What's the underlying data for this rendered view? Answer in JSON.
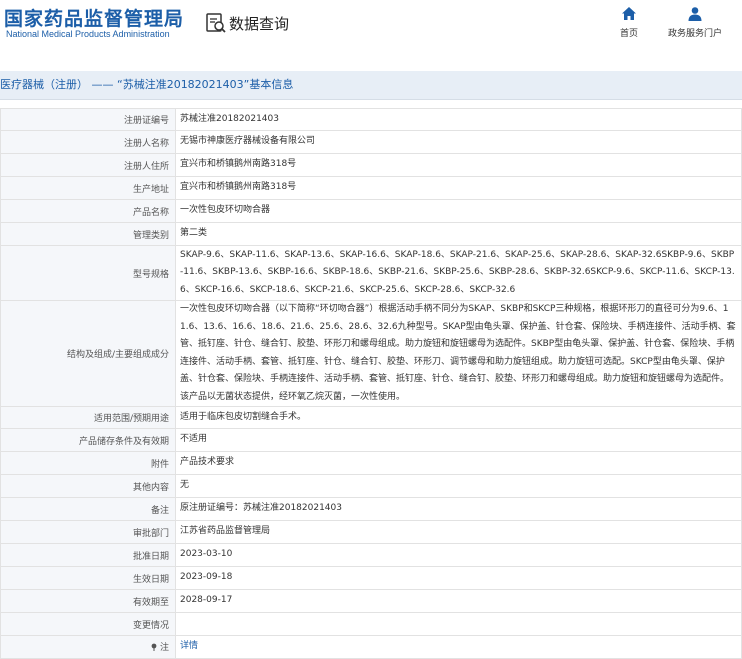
{
  "header": {
    "logo_cn": "国家药品监督管理局",
    "logo_en": "National Medical Products Administration",
    "query_label": "数据查询",
    "nav": {
      "home": "首页",
      "portal": "政务服务门户"
    }
  },
  "title": "医疗器械（注册） —— “苏械注准20182021403”基本信息",
  "rows": [
    {
      "k": "注册证编号",
      "v": "苏械注准20182021403"
    },
    {
      "k": "注册人名称",
      "v": "无锡市神康医疗器械设备有限公司"
    },
    {
      "k": "注册人住所",
      "v": "宜兴市和桥镇鹅州南路318号"
    },
    {
      "k": "生产地址",
      "v": "宜兴市和桥镇鹅州南路318号"
    },
    {
      "k": "产品名称",
      "v": "一次性包皮环切吻合器"
    },
    {
      "k": "管理类别",
      "v": "第二类"
    },
    {
      "k": "型号规格",
      "v": "SKAP-9.6、SKAP-11.6、SKAP-13.6、SKAP-16.6、SKAP-18.6、SKAP-21.6、SKAP-25.6、SKAP-28.6、SKAP-32.6SKBP-9.6、SKBP-11.6、SKBP-13.6、SKBP-16.6、SKBP-18.6、SKBP-21.6、SKBP-25.6、SKBP-28.6、SKBP-32.6SKCP-9.6、SKCP-11.6、SKCP-13.6、SKCP-16.6、SKCP-18.6、SKCP-21.6、SKCP-25.6、SKCP-28.6、SKCP-32.6"
    },
    {
      "k": "结构及组成/主要组成成分",
      "v": "一次性包皮环切吻合器（以下简称“环切吻合器”）根据活动手柄不同分为SKAP、SKBP和SKCP三种规格，根据环形刀的直径可分为9.6、11.6、13.6、16.6、18.6、21.6、25.6、28.6、32.6九种型号。SKAP型由龟头罩、保护盖、针仓套、保险块、手柄连接件、活动手柄、套管、抵钉座、针仓、缝合钉、胶垫、环形刀和螺母组成。助力旋钮和旋钮螺母为选配件。SKBP型由龟头罩、保护盖、针仓套、保险块、手柄连接件、活动手柄、套管、抵钉座、针仓、缝合钉、胶垫、环形刀、调节螺母和助力旋钮组成。助力旋钮可选配。SKCP型由龟头罩、保护盖、针仓套、保险块、手柄连接件、活动手柄、套管、抵钉座、针仓、缝合钉、胶垫、环形刀和螺母组成。助力旋钮和旋钮螺母为选配件。该产品以无菌状态提供，经环氧乙烷灭菌，一次性使用。"
    },
    {
      "k": "适用范围/预期用途",
      "v": "适用于临床包皮切割缝合手术。"
    },
    {
      "k": "产品储存条件及有效期",
      "v": "不适用"
    },
    {
      "k": "附件",
      "v": "产品技术要求"
    },
    {
      "k": "其他内容",
      "v": "无"
    },
    {
      "k": "备注",
      "v": "原注册证编号：苏械注准20182021403"
    },
    {
      "k": "审批部门",
      "v": "江苏省药品监督管理局"
    },
    {
      "k": "批准日期",
      "v": "2023-03-10"
    },
    {
      "k": "生效日期",
      "v": "2023-09-18"
    },
    {
      "k": "有效期至",
      "v": "2028-09-17"
    },
    {
      "k": "变更情况",
      "v": ""
    }
  ],
  "note": {
    "k": "注",
    "v": "详情"
  },
  "colors": {
    "brand": "#1c5ea8",
    "title_bg": "#e7eef6",
    "key_bg": "#f5f7fa",
    "border": "#e2e2e2"
  }
}
